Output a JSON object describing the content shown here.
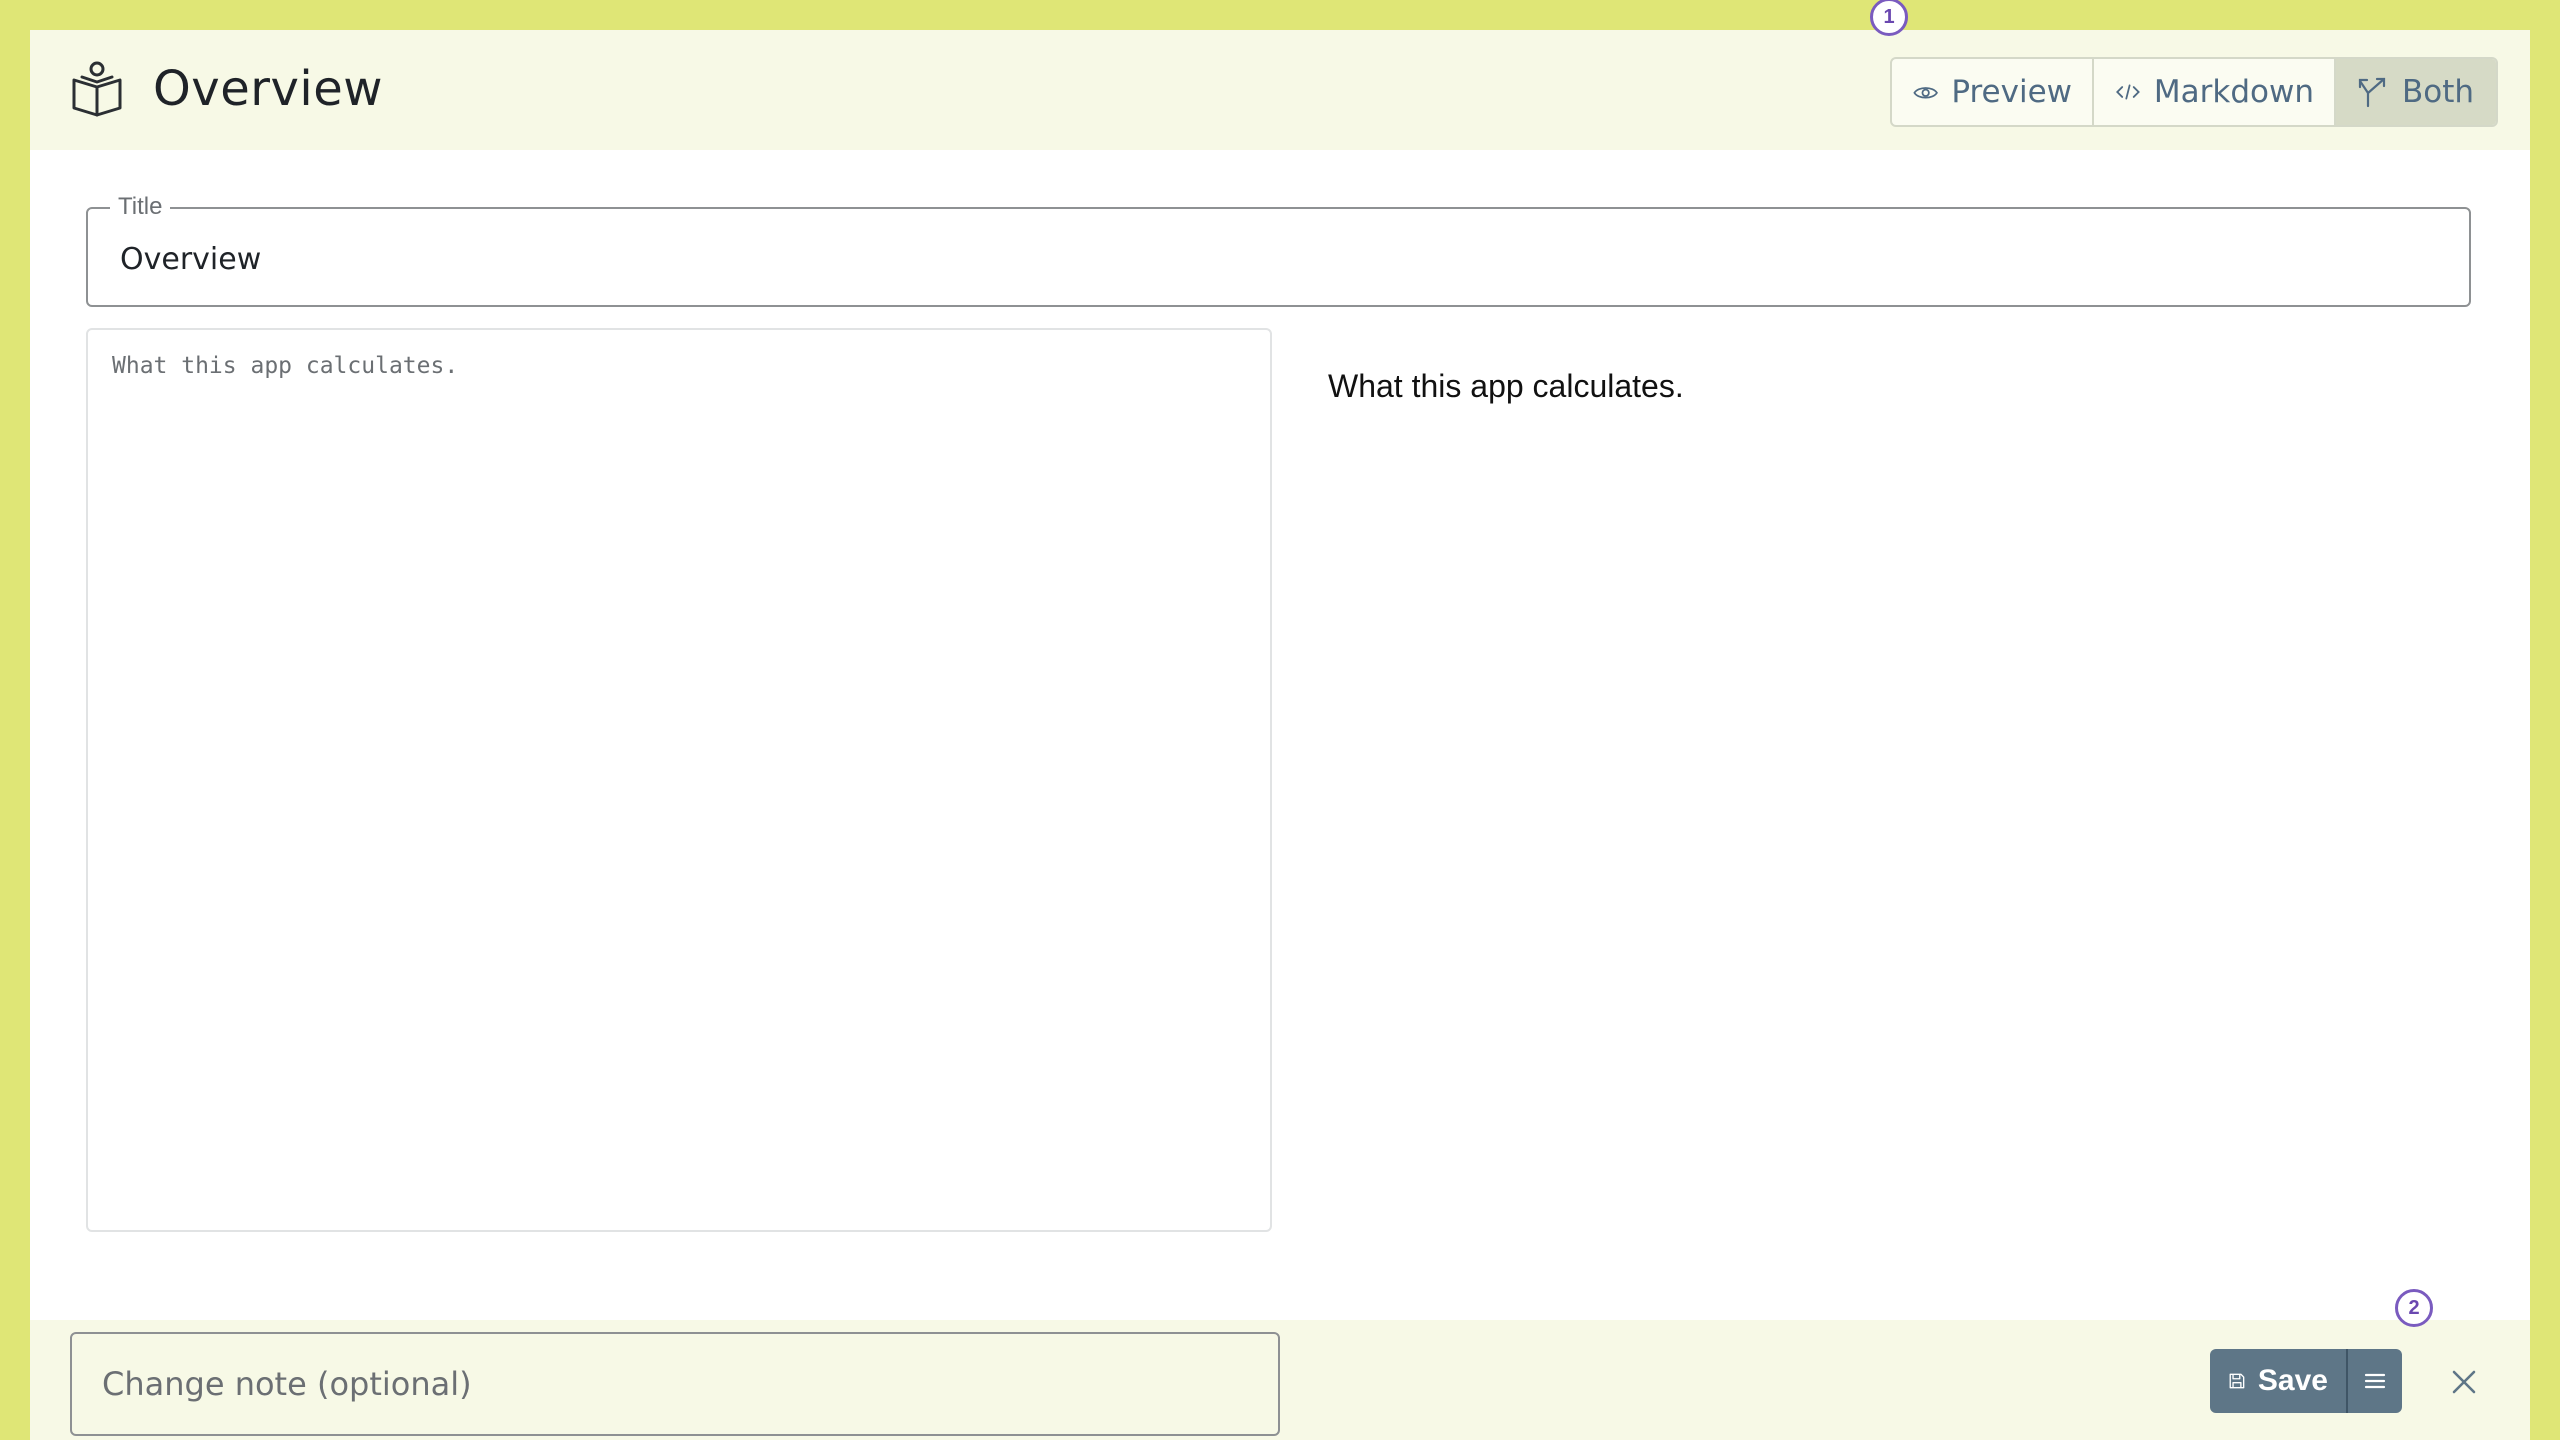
{
  "header": {
    "title": "Overview",
    "view_modes": [
      {
        "label": "Preview",
        "icon": "eye-icon"
      },
      {
        "label": "Markdown",
        "icon": "code-icon"
      },
      {
        "label": "Both",
        "icon": "split-icon",
        "active": true
      }
    ]
  },
  "form": {
    "title_label": "Title",
    "title_value": "Overview",
    "editor_text": "What this app calculates.",
    "preview_text": "What this app calculates."
  },
  "footer": {
    "change_note_placeholder": "Change note (optional)",
    "save_label": "Save"
  },
  "badges": [
    "1",
    "2"
  ],
  "colors": {
    "outer_background": "#dfe676",
    "panel_background": "#f7f9e6",
    "save_button": "#5e7687",
    "badge_accent": "#7a5bbf"
  }
}
